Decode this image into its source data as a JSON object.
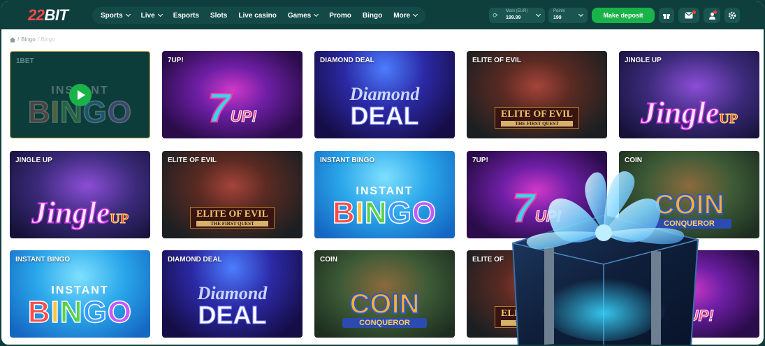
{
  "header": {
    "logo_num": "22",
    "logo_txt": "BIT",
    "nav": [
      {
        "label": "Sports",
        "has_menu": true
      },
      {
        "label": "Live",
        "has_menu": true
      },
      {
        "label": "Esports",
        "has_menu": false
      },
      {
        "label": "Slots",
        "has_menu": false
      },
      {
        "label": "Live casino",
        "has_menu": false
      },
      {
        "label": "Games",
        "has_menu": true
      },
      {
        "label": "Promo",
        "has_menu": false
      },
      {
        "label": "Bingo",
        "has_menu": false
      },
      {
        "label": "More",
        "has_menu": true
      }
    ],
    "balance": {
      "label": "Main (EUR)",
      "value": "199.99"
    },
    "points": {
      "label": "Points",
      "value": "199"
    },
    "deposit_label": "Make deposit"
  },
  "breadcrumb": {
    "sep": "/",
    "item1": "Bingo",
    "current": "/ Bingo"
  },
  "tiles": [
    {
      "title": "1BET",
      "theme": "bingo",
      "active": true
    },
    {
      "title": "7UP!",
      "theme": "7up"
    },
    {
      "title": "DIAMOND DEAL",
      "theme": "diamond"
    },
    {
      "title": "ELITE OF EVIL",
      "theme": "evil"
    },
    {
      "title": "JINGLE UP",
      "theme": "jingle"
    },
    {
      "title": "JINGLE UP",
      "theme": "jingle"
    },
    {
      "title": "ELITE OF EVIL",
      "theme": "evil"
    },
    {
      "title": "INSTANT BINGO",
      "theme": "bingo"
    },
    {
      "title": "7UP!",
      "theme": "7up"
    },
    {
      "title": "COIN",
      "theme": "coin"
    },
    {
      "title": "INSTANT BINGO",
      "theme": "bingo"
    },
    {
      "title": "DIAMOND DEAL",
      "theme": "diamond"
    },
    {
      "title": "COIN",
      "theme": "coin"
    },
    {
      "title": "ELITE OF",
      "theme": "evil"
    },
    {
      "title": "",
      "theme": "7up"
    }
  ],
  "art": {
    "sevenup_main": "7",
    "sevenup_sub": "UP!",
    "diamond_a": "Diamond",
    "diamond_b": "DEAL",
    "evil_a": "ELITE OF EVIL",
    "evil_b": "THE FIRST QUEST",
    "jingle_a": "Jingle",
    "jingle_b": "UP",
    "bingo_a": "INSTANT",
    "bingo_b": [
      "B",
      "I",
      "N",
      "G",
      "O"
    ],
    "coin_a": "COIN",
    "coin_b": "CONQUEROR"
  },
  "colors": {
    "header_bg": "#0f3f3d",
    "accent_green": "#19b34a",
    "logo_red": "#ff4a4a"
  }
}
